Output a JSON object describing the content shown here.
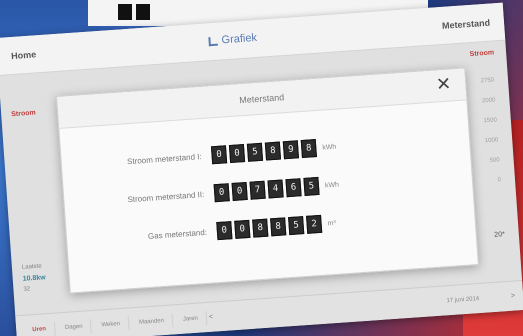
{
  "app": {
    "nav_home": "Home",
    "title": "Grafiek",
    "nav_meterstand": "Meterstand"
  },
  "side": {
    "left_label": "Stroom",
    "right_button": "Stroom",
    "axis": [
      "2750",
      "2000",
      "1500",
      "1000",
      "500",
      "0"
    ]
  },
  "bottom": {
    "caption": "Laatste",
    "value": "10.8kw",
    "sub": "32",
    "right_value": "20*"
  },
  "tabs": {
    "items": [
      "Uren",
      "Dagen",
      "Weken",
      "Maanden",
      "Jaren"
    ],
    "active_index": 0,
    "date": "17 juni 2014",
    "prev": "<",
    "next": ">"
  },
  "modal": {
    "title": "Meterstand",
    "close": "✕",
    "rows": [
      {
        "label": "Stroom meterstand I:",
        "digits": [
          "0",
          "0",
          "5",
          "8",
          "9",
          "8"
        ],
        "unit": "kWh"
      },
      {
        "label": "Stroom meterstand II:",
        "digits": [
          "0",
          "0",
          "7",
          "4",
          "6",
          "5"
        ],
        "unit": "kWh"
      },
      {
        "label": "Gas meterstand:",
        "digits": [
          "0",
          "0",
          "8",
          "8",
          "5",
          "2"
        ],
        "unit": "m³"
      }
    ]
  },
  "colors": {
    "accent_red": "#c94444",
    "accent_blue": "#5b7bb4",
    "digit_bg": "#2b2b2b"
  }
}
